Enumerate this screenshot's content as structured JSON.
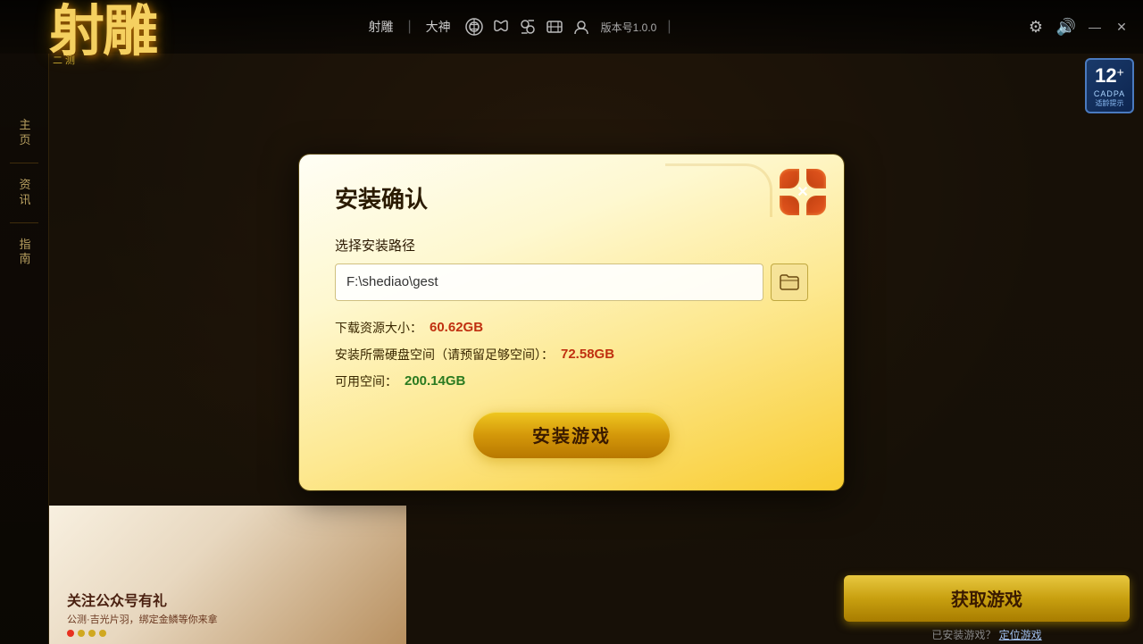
{
  "app": {
    "title": "射雕",
    "version": "版本号1.0.0"
  },
  "topbar": {
    "nav_items": [
      "射雕",
      "大神",
      "",
      "",
      "",
      "",
      ""
    ],
    "game_label": "射雕",
    "dashen_label": "大神",
    "version_label": "版本号1.0.0"
  },
  "logo": {
    "main": "射雕",
    "sub": "二测"
  },
  "sidebar": {
    "items": [
      {
        "label": "主\n页",
        "id": "home"
      },
      {
        "label": "资\n讯",
        "id": "news"
      },
      {
        "label": "指\n南",
        "id": "guide"
      }
    ]
  },
  "rating": {
    "number": "12",
    "plus": "+",
    "label": "CADPA",
    "sublabel": "适龄提示"
  },
  "dialog": {
    "title": "安装确认",
    "close_label": "×",
    "path_label": "选择安装路径",
    "path_value": "F:\\shediao\\gest",
    "download_size_label": "下载资源大小：",
    "download_size_value": "60.62GB",
    "disk_label": "安装所需硬盘空间（请预留足够空间）：",
    "disk_value": "72.58GB",
    "free_label": "可用空间：",
    "free_value": "200.14GB",
    "install_btn": "安装游戏"
  },
  "bottom": {
    "banner_text": "关注公众号有礼",
    "banner_sub": "公测·吉光片羽，绑定金鳞等你来拿",
    "dots": [
      "#e83020",
      "#d0a820",
      "#d0a820",
      "#d0a820"
    ],
    "get_game_btn": "获取游戏",
    "installed_text": "已安装游戏？",
    "locate_label": "定位游戏"
  },
  "icons": {
    "folder": "🗀",
    "settings": "⚙",
    "sound": "🔊",
    "minimize": "—",
    "close": "✕"
  }
}
